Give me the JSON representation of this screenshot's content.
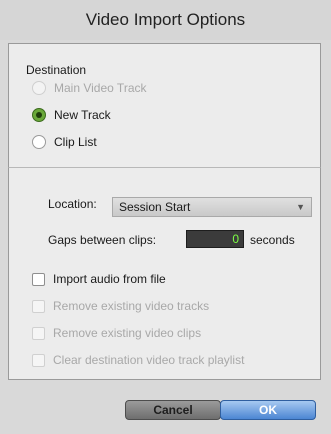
{
  "window": {
    "title": "Video Import Options"
  },
  "destination": {
    "label": "Destination",
    "options": [
      {
        "label": "Main Video Track",
        "selected": false,
        "enabled": false
      },
      {
        "label": "New Track",
        "selected": true,
        "enabled": true
      },
      {
        "label": "Clip List",
        "selected": false,
        "enabled": true
      }
    ]
  },
  "location": {
    "label": "Location:",
    "value": "Session Start"
  },
  "gaps": {
    "label": "Gaps between clips:",
    "value": "0",
    "unit": "seconds"
  },
  "checkboxes": [
    {
      "label": "Import audio from file",
      "checked": false,
      "enabled": true
    },
    {
      "label": "Remove existing video tracks",
      "checked": false,
      "enabled": false
    },
    {
      "label": "Remove existing video clips",
      "checked": false,
      "enabled": false
    },
    {
      "label": "Clear destination video track playlist",
      "checked": false,
      "enabled": false
    }
  ],
  "buttons": {
    "cancel": "Cancel",
    "ok": "OK"
  },
  "colors": {
    "ok_button": "#4c86d3",
    "selected_radio": "#6aa83a",
    "field_text": "#7cff45"
  }
}
